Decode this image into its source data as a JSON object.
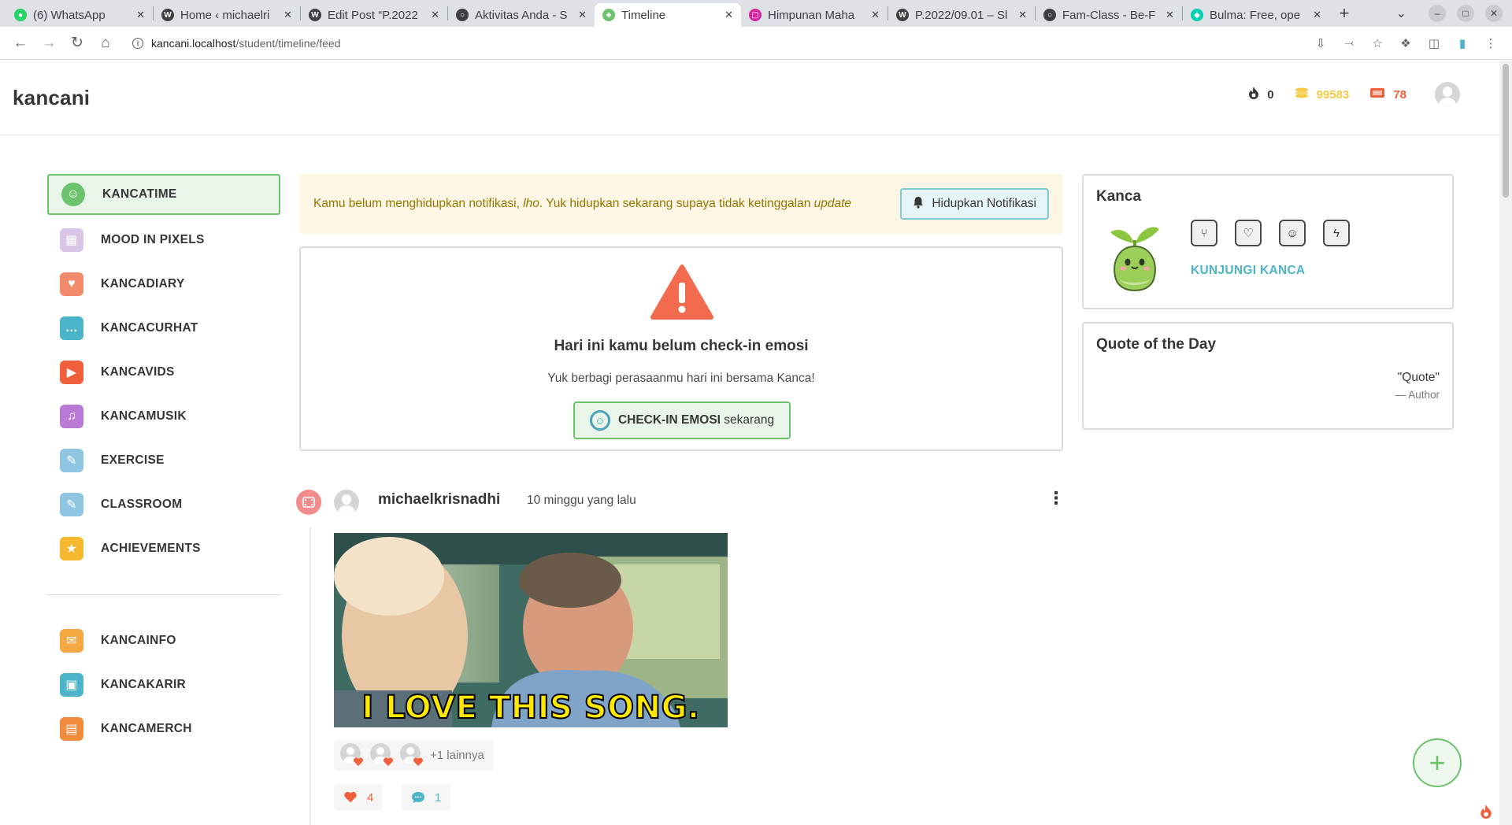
{
  "browser": {
    "tabs": [
      {
        "title": "(6) WhatsApp",
        "icon": "whatsapp-icon",
        "color": "#25d366",
        "active": false
      },
      {
        "title": "Home ‹ michaelri",
        "icon": "wordpress-icon",
        "color": "#3c4043",
        "active": false
      },
      {
        "title": "Edit Post “P.2022",
        "icon": "wordpress-icon",
        "color": "#3c4043",
        "active": false
      },
      {
        "title": "Aktivitas Anda - S",
        "icon": "globe-icon",
        "color": "#3c4043",
        "active": false
      },
      {
        "title": "Timeline",
        "icon": "kancani-icon",
        "color": "#6cc36c",
        "active": true
      },
      {
        "title": "Himpunan Maha",
        "icon": "instagram-icon",
        "color": "#d6249f",
        "active": false
      },
      {
        "title": "P.2022/09.01 – Sl",
        "icon": "wordpress-icon",
        "color": "#3c4043",
        "active": false
      },
      {
        "title": "Fam-Class - Be-F",
        "icon": "globe-icon",
        "color": "#3c4043",
        "active": false
      },
      {
        "title": "Bulma: Free, ope",
        "icon": "bulma-icon",
        "color": "#00d1b2",
        "active": false
      }
    ],
    "close_glyph": "✕",
    "new_tab_glyph": "+",
    "url_host": "kancani.localhost",
    "url_path": "/student/timeline/feed"
  },
  "header": {
    "brand": "kancani",
    "streak": "0",
    "coins": "99583",
    "tickets": "78",
    "colors": {
      "streak": "#363636",
      "coins": "#f7c948",
      "tickets": "#f0603c"
    }
  },
  "sidebar": {
    "items": [
      {
        "label": "KANCATIME",
        "icon": "kancatime-icon",
        "color": "#6cc36c",
        "glyph": "☺"
      },
      {
        "label": "MOOD IN PIXELS",
        "icon": "calendar-icon",
        "color": "#d9c6e6",
        "glyph": "▦"
      },
      {
        "label": "KANCADIARY",
        "icon": "diary-icon",
        "color": "#f28b6b",
        "glyph": "♥"
      },
      {
        "label": "KANCACURHAT",
        "icon": "chat-bubble-icon",
        "color": "#4bb4c8",
        "glyph": "…"
      },
      {
        "label": "KANCAVIDS",
        "icon": "play-icon",
        "color": "#f0603c",
        "glyph": "▶"
      },
      {
        "label": "KANCAMUSIK",
        "icon": "headphones-icon",
        "color": "#b97ad6",
        "glyph": "♫"
      },
      {
        "label": "EXERCISE",
        "icon": "pencil-icon",
        "color": "#8ec5e0",
        "glyph": "✎"
      },
      {
        "label": "CLASSROOM",
        "icon": "pencil-icon",
        "color": "#8ec5e0",
        "glyph": "✎"
      },
      {
        "label": "ACHIEVEMENTS",
        "icon": "trophy-icon",
        "color": "#f5b82e",
        "glyph": "★"
      }
    ],
    "items2": [
      {
        "label": "KANCAINFO",
        "icon": "envelope-icon",
        "color": "#f5a742",
        "glyph": "✉"
      },
      {
        "label": "KANCAKARIR",
        "icon": "briefcase-icon",
        "color": "#4bb4c8",
        "glyph": "▣"
      },
      {
        "label": "KANCAMERCH",
        "icon": "shopping-bag-icon",
        "color": "#f28b3c",
        "glyph": "▤"
      }
    ]
  },
  "notification": {
    "text_a": "Kamu belum menghidupkan notifikasi, ",
    "text_em1": "lho",
    "text_b": ". Yuk hidupkan sekarang supaya tidak ketinggalan ",
    "text_em2": "update",
    "button": "Hidupkan Notifikasi"
  },
  "checkin": {
    "title": "Hari ini kamu belum check-in emosi",
    "subtitle": "Yuk berbagi perasaanmu hari ini bersama Kanca!",
    "button_strong": "CHECK-IN EMOSI",
    "button_rest": "sekarang"
  },
  "post": {
    "author": "michaelkrisnadhi",
    "time": "10 minggu yang lalu",
    "gif_caption": "I LOVE THIS SONG.",
    "reactors_more": "+1 lainnya",
    "like_count": "4",
    "comment_count": "1",
    "colors": {
      "like": "#f0603c",
      "comment": "#4bb4c8"
    }
  },
  "kanca": {
    "title": "Kanca",
    "stat_icons": [
      "utensils-icon",
      "heartbeat-icon",
      "smile-icon",
      "bolt-icon"
    ],
    "stat_glyphs": [
      "⑂",
      "♡",
      "☺",
      "ϟ"
    ],
    "link": "KUNJUNGI KANCA"
  },
  "quote": {
    "title": "Quote of the Day",
    "text": "\"Quote\"",
    "author": "— Author"
  },
  "fab": {
    "glyph": "+"
  }
}
